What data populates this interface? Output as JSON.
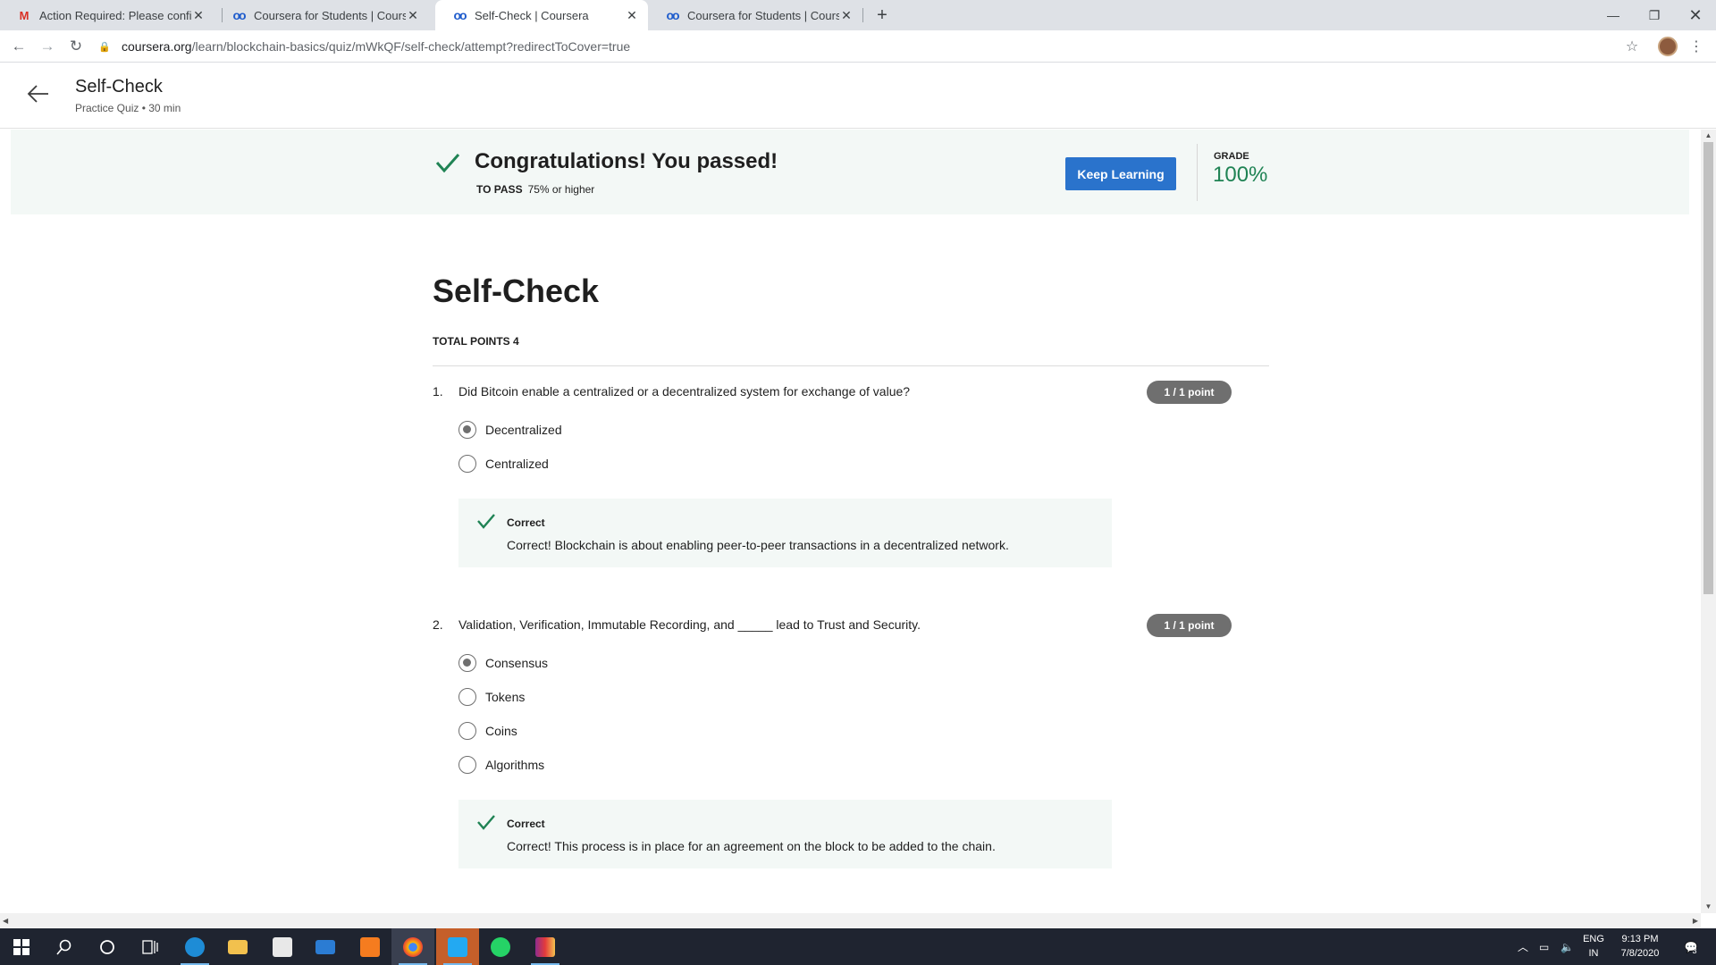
{
  "browser": {
    "tabs": [
      {
        "title": "Action Required: Please confirm y",
        "icon": "gmail-icon"
      },
      {
        "title": "Coursera for Students | Coursera",
        "icon": "coursera-icon"
      },
      {
        "title": "Self-Check | Coursera",
        "icon": "coursera-icon",
        "active": true
      },
      {
        "title": "Coursera for Students | Coursera",
        "icon": "coursera-icon"
      }
    ],
    "url_host": "coursera.org",
    "url_path": "/learn/blockchain-basics/quiz/mWkQF/self-check/attempt?redirectToCover=true"
  },
  "header": {
    "title": "Self-Check",
    "subtitle": "Practice Quiz • 30 min"
  },
  "banner": {
    "headline": "Congratulations! You passed!",
    "to_pass_label": "TO PASS",
    "to_pass_value": "75% or higher",
    "keep_learning": "Keep Learning",
    "grade_label": "GRADE",
    "grade_value": "100%",
    "accent": "#1f8354",
    "button_color": "#2a73cc"
  },
  "quiz": {
    "title": "Self-Check",
    "total_points": "TOTAL POINTS 4",
    "questions": [
      {
        "number": "1.",
        "text": "Did Bitcoin enable a centralized or a decentralized system for exchange of value?",
        "points": "1 / 1 point",
        "options": [
          "Decentralized",
          "Centralized"
        ],
        "selected": 0,
        "feedback_title": "Correct",
        "feedback_text": "Correct! Blockchain is about enabling peer-to-peer transactions in a decentralized network."
      },
      {
        "number": "2.",
        "text": "Validation, Verification, Immutable Recording, and _____ lead to Trust and Security.",
        "points": "1 / 1 point",
        "options": [
          "Consensus",
          "Tokens",
          "Coins",
          "Algorithms"
        ],
        "selected": 0,
        "feedback_title": "Correct",
        "feedback_text": "Correct! This process is in place for an agreement on the block to be added to the chain."
      }
    ]
  },
  "taskbar": {
    "lang_top": "ENG",
    "lang_bottom": "IN",
    "time": "9:13 PM",
    "date": "7/8/2020",
    "notifications": "3"
  }
}
